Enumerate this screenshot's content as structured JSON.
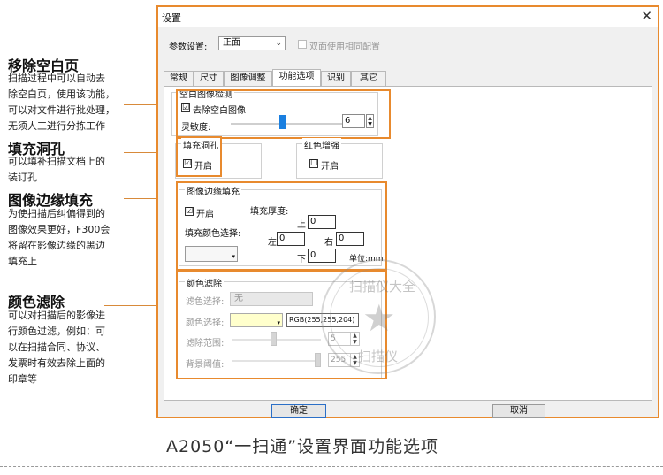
{
  "annotations": {
    "remove_blank": {
      "title": "移除空白页",
      "lines": [
        "扫描过程中可以自动去",
        "除空白页，使用该功能，",
        "可以对文件进行批处理，",
        "无须人工进行分拣工作"
      ]
    },
    "fill_holes": {
      "title": "填充洞孔",
      "lines": [
        "可以填补扫描文档上的",
        "装订孔"
      ]
    },
    "edge_fill": {
      "title": "图像边缘填充",
      "lines": [
        "为使扫描后纠偏得到的",
        "图像效果更好，F300会",
        "将留在影像边缘的黑边",
        "填充上"
      ]
    },
    "color_filter": {
      "title": "颜色滤除",
      "lines": [
        "可以对扫描后的影像进",
        "行颜色过滤，例如：可",
        "以在扫描合同、协议、",
        "发票时有效去除上面的",
        "印章等"
      ]
    }
  },
  "dialog": {
    "title": "设置",
    "close_glyph": "✕",
    "param_label": "参数设置:",
    "param_value": "正面",
    "duplex_label": "双面使用相同配置",
    "tabs": [
      "常规",
      "尺寸",
      "图像调整",
      "功能选项",
      "识别",
      "其它"
    ],
    "active_tab": "功能选项",
    "blank_detect": {
      "title": "空白图像检测",
      "remove_label": "去除空白图像",
      "remove_checked": "☑",
      "sensitivity_label": "灵敏度:",
      "sensitivity_value": "6",
      "sensitivity_level": 0.45
    },
    "fill_holes": {
      "title": "填充洞孔",
      "enable_label": "开启",
      "checked": "☑"
    },
    "red_enhance": {
      "title": "红色增强",
      "enable_label": "开启",
      "checked": "☐"
    },
    "edge_fill": {
      "title": "图像边缘填充",
      "enable_label": "开启",
      "checked": "☑",
      "thickness_label": "填充厚度:",
      "top_label": "上",
      "top_value": "0",
      "left_label": "左",
      "left_value": "0",
      "right_label": "右",
      "right_value": "0",
      "bottom_label": "下",
      "bottom_value": "0",
      "unit_label": "单位:mm",
      "color_label": "填充颜色选择:"
    },
    "color_filter": {
      "title": "颜色滤除",
      "filter_select_label": "滤色选择:",
      "filter_select_value": "无",
      "color_select_label": "颜色选择:",
      "color_value": "RGB(255,255,204)",
      "swatch_color": "#ffffcc",
      "range_label": "滤除范围:",
      "range_value": "5",
      "threshold_label": "背景阈值:",
      "threshold_value": "255"
    },
    "ok_label": "确定",
    "cancel_label": "取消"
  },
  "caption": "A2050“一扫通”设置界面功能选项",
  "watermark": {
    "top_text": "扫描仪大全",
    "bottom_text": "扫描仪"
  },
  "colors": {
    "highlight": "#e88a2e",
    "accent": "#2b6fc7"
  }
}
